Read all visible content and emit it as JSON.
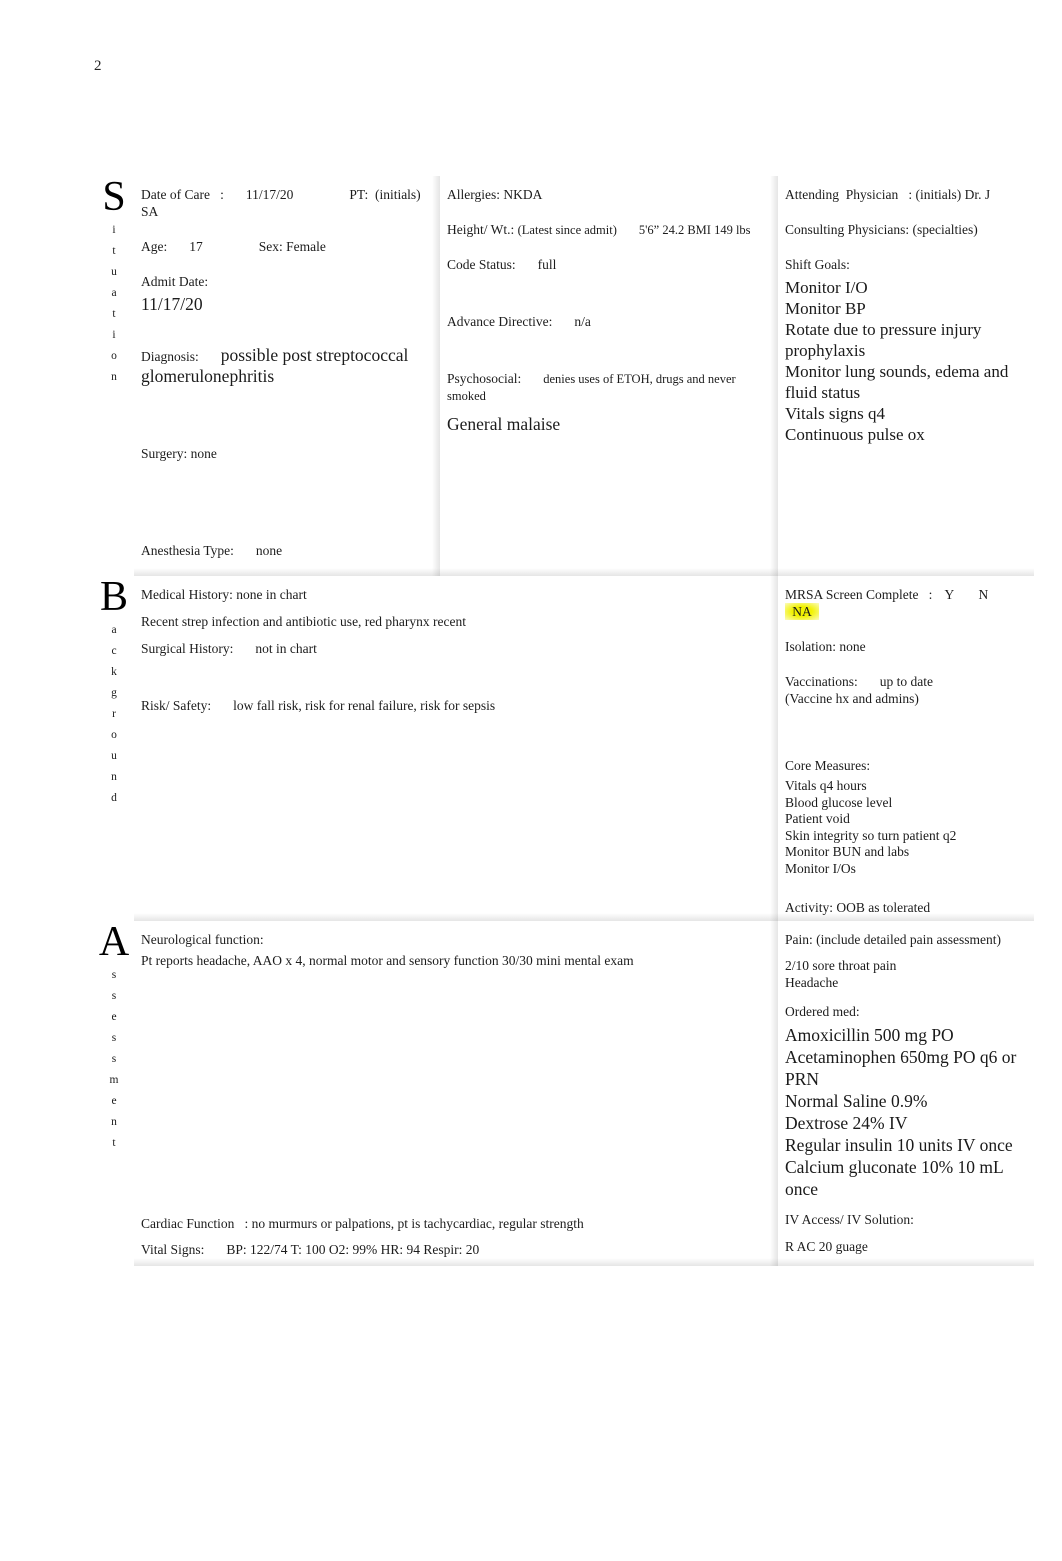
{
  "page": {
    "number": "2"
  },
  "sections": {
    "situation": {
      "big_letter": "S",
      "stacked": "ituation",
      "col1": {
        "date_of_care_label": "Date of Care   :",
        "date_of_care_value": "11/17/20",
        "pt_label": "PT:  (initials)",
        "pt_value": "SA",
        "age_label": "Age:",
        "age_value": "17",
        "sex_label": "Sex:",
        "sex_value": "Female",
        "admit_date_label": "Admit Date:",
        "admit_date_value": "11/17/20",
        "diagnosis_label": "Diagnosis:",
        "diagnosis_value": "possible post streptococcal glomerulonephritis",
        "surgery_label": "Surgery:",
        "surgery_value": "none",
        "anesthesia_label": "Anesthesia Type:",
        "anesthesia_value": "none"
      },
      "col2": {
        "allergies_label": "Allergies:",
        "allergies_value": "NKDA",
        "height_wt_label": "Height/ Wt.:",
        "height_wt_hint": "(Latest since admit)",
        "height_wt_value": "5'6” 24.2 BMI 149 lbs",
        "code_status_label": "Code Status:",
        "code_status_value": "full",
        "advance_directive_label": "Advance Directive:",
        "advance_directive_value": "n/a",
        "psychosocial_label": "Psychosocial:",
        "psychosocial_value": "denies uses of ETOH, drugs and never smoked",
        "general_note": "General malaise"
      },
      "col3": {
        "attending_label": "Attending  Physician   : (initials)",
        "attending_value": "Dr. J",
        "consulting_label": "Consulting Physicians: (specialties)",
        "shift_goals_label": "Shift Goals:",
        "shift_goals": [
          "Monitor I/O",
          "Monitor BP",
          "Rotate due to pressure injury prophylaxis",
          "Monitor lung sounds, edema and fluid status",
          "Vitals signs q4",
          "Continuous pulse ox"
        ]
      }
    },
    "background": {
      "big_letter": "B",
      "stacked": "ackground",
      "col1": {
        "medical_history_label": "Medical History:",
        "medical_history_value": "none in chart",
        "medical_history_note": "Recent strep infection and antibiotic use, red pharynx recent",
        "surgical_history_label": "Surgical History:",
        "surgical_history_value": "not in chart",
        "risk_safety_label": "Risk/ Safety:",
        "risk_safety_value": "low fall risk, risk for renal failure, risk for sepsis"
      },
      "col3": {
        "mrsa_label": "MRSA Screen Complete   :",
        "mrsa_options": [
          "Y",
          "N",
          "NA"
        ],
        "mrsa_selected": "NA",
        "isolation_label": "Isolation:",
        "isolation_value": "none",
        "vaccinations_label": "Vaccinations:",
        "vaccinations_value": "up to date",
        "vaccinations_hint": "(Vaccine hx and admins)",
        "core_measures_label": "Core Measures:",
        "core_measures": [
          "Vitals q4 hours",
          "Blood glucose level",
          "Patient void",
          "Skin integrity so turn patient q2",
          "Monitor BUN and labs",
          "Monitor I/Os"
        ],
        "activity_label": "Activity:",
        "activity_value": "OOB as tolerated"
      }
    },
    "assessment": {
      "big_letter": "A",
      "stacked": "ssessment",
      "col1": {
        "neuro_label": "Neurological function:",
        "neuro_value": "Pt reports headache, AAO x 4, normal motor and sensory function 30/30 mini mental exam",
        "cardiac_label": "Cardiac Function   :",
        "cardiac_value": "no murmurs or palpations, pt is tachycardiac, regular strength",
        "vitals_label": "Vital Signs:",
        "vitals_value": "BP: 122/74 T: 100 O2: 99% HR: 94 Respir: 20"
      },
      "col3": {
        "pain_label": "Pain: (include detailed pain assessment)",
        "pain_items": [
          "2/10 sore throat pain",
          "Headache"
        ],
        "ordered_med_label": "Ordered med:",
        "ordered_meds": [
          "Amoxicillin 500 mg PO",
          "Acetaminophen 650mg PO q6 or PRN",
          "Normal Saline 0.9%",
          "Dextrose 24% IV",
          "Regular insulin 10 units IV once",
          "Calcium gluconate 10% 10 mL once"
        ],
        "iv_access_label": "IV Access/ IV Solution:",
        "iv_access_value": "R AC 20 guage"
      }
    }
  },
  "colors": {
    "highlight": "#f2f200",
    "text": "#1a1a1a",
    "page_bg": "#ffffff"
  }
}
